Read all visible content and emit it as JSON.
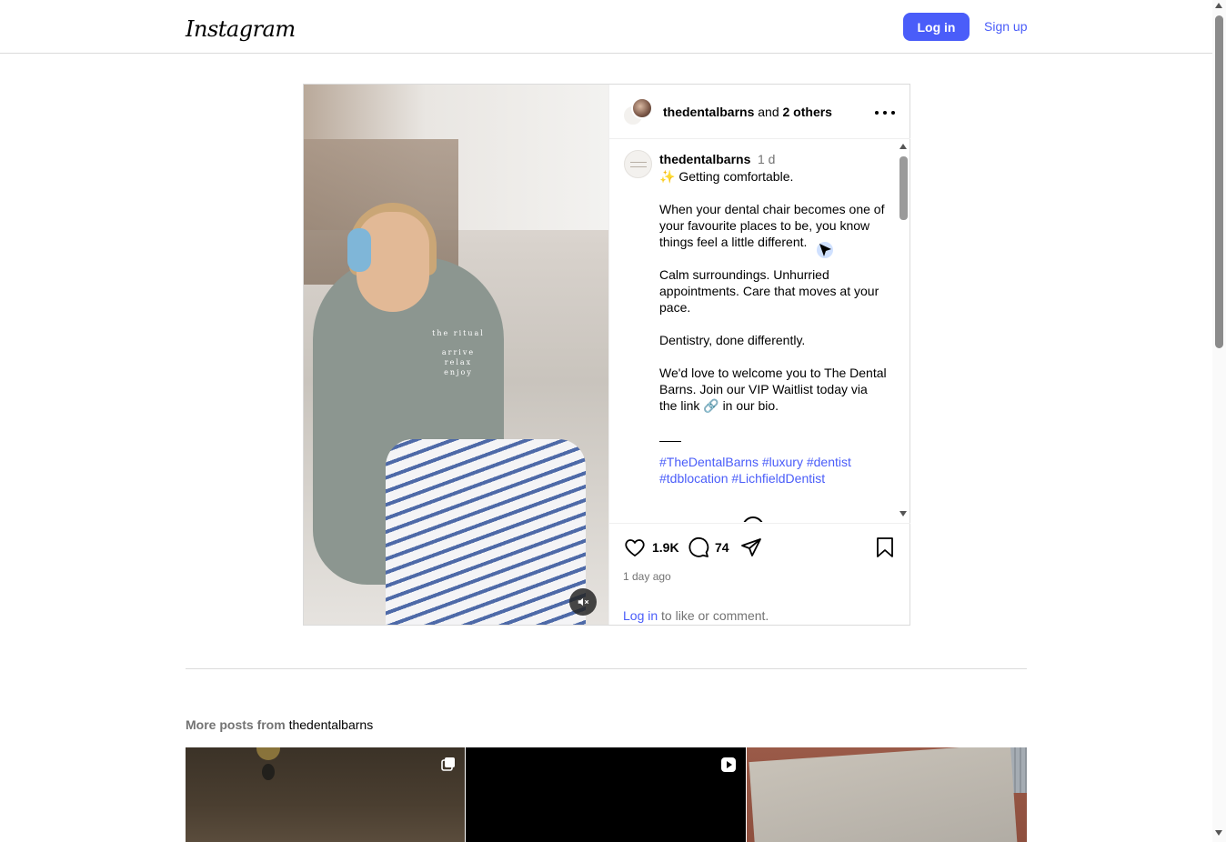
{
  "nav": {
    "logo": "Instagram",
    "login_label": "Log in",
    "signup_label": "Sign up"
  },
  "post": {
    "header": {
      "user": "thedentalbarns",
      "and_text": "and",
      "others": "2 others"
    },
    "caption": {
      "user": "thedentalbarns",
      "time": "1 d",
      "line1": "✨ Getting comfortable.",
      "para1": "When your dental chair becomes one of your favourite places to be, you know things feel a little different.",
      "para2": "Calm surroundings. Unhurried appointments. Care that moves at your pace.",
      "para3": "Dentistry, done differently.",
      "para4": "We'd love to welcome you to The Dental Barns. Join our VIP Waitlist today via the link 🔗 in our bio.",
      "tags": "#TheDentalBarns #luxury #dentist #tdblocation #LichfieldDentist"
    },
    "media": {
      "overlay": {
        "line1": "the ritual",
        "line2": "arrive",
        "line3": "relax",
        "line4": "enjoy"
      }
    },
    "actions": {
      "likes": "1.9K",
      "comments": "74",
      "time_ago": "1 day ago",
      "login_link": "Log in",
      "login_suffix": " to like or comment."
    }
  },
  "more_posts": {
    "prefix": "More posts from",
    "user": "thedentalbarns",
    "tiles": [
      {
        "type": "carousel"
      },
      {
        "type": "reel"
      },
      {
        "type": "image"
      }
    ]
  },
  "icons": {
    "like": "heart-icon",
    "comment": "comment-icon",
    "share": "share-icon",
    "save": "bookmark-icon",
    "more": "more-icon",
    "mute": "muted-speaker-icon",
    "carousel": "carousel-icon",
    "reel": "reel-icon"
  },
  "colors": {
    "accent": "#4a5df9",
    "muted_text": "#737373",
    "border": "#dbdbdb"
  }
}
